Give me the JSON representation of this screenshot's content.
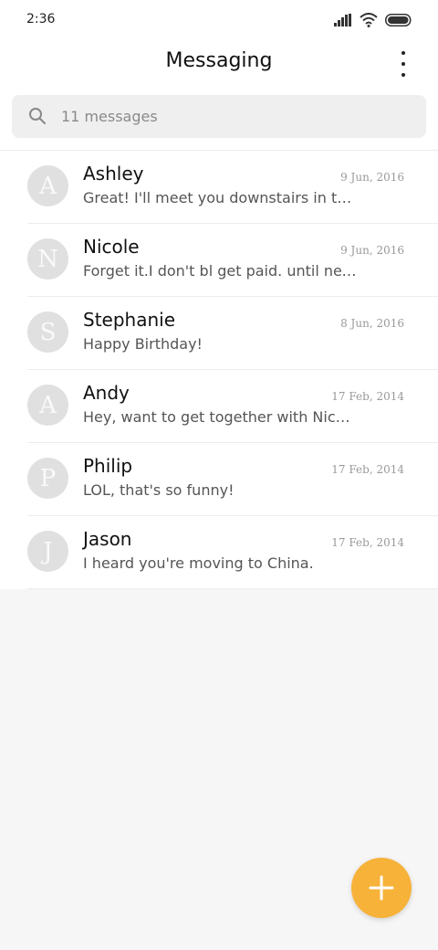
{
  "status_bar": {
    "time": "2:36",
    "icons": [
      "signal-icon",
      "wifi-icon",
      "battery-icon"
    ]
  },
  "header": {
    "title": "Messaging",
    "menu_icon": "more-vertical-icon"
  },
  "search": {
    "placeholder": "11 messages",
    "icon": "search-icon"
  },
  "conversations": [
    {
      "initial": "A",
      "name": "Ashley",
      "date": "9 Jun, 2016",
      "preview": "Great! I'll meet you downstairs in ten minutes."
    },
    {
      "initial": "N",
      "name": "Nicole",
      "date": "9 Jun, 2016",
      "preview": "Forget it.I don't bl get paid. until next week."
    },
    {
      "initial": "S",
      "name": "Stephanie",
      "date": "8 Jun, 2016",
      "preview": "Happy Birthday!"
    },
    {
      "initial": "A",
      "name": "Andy",
      "date": "17 Feb, 2014",
      "preview": "Hey, want to get together with Nicole tonight?"
    },
    {
      "initial": "P",
      "name": "Philip",
      "date": "17 Feb, 2014",
      "preview": "LOL, that's so funny!"
    },
    {
      "initial": "J",
      "name": "Jason",
      "date": "17 Feb, 2014",
      "preview": "I heard you're moving to China."
    }
  ],
  "fab": {
    "icon": "plus-icon",
    "color": "#f7b23a"
  },
  "colors": {
    "accent": "#f7b23a",
    "background": "#f6f6f6",
    "surface": "#ffffff",
    "avatar": "#e0e0e0"
  }
}
